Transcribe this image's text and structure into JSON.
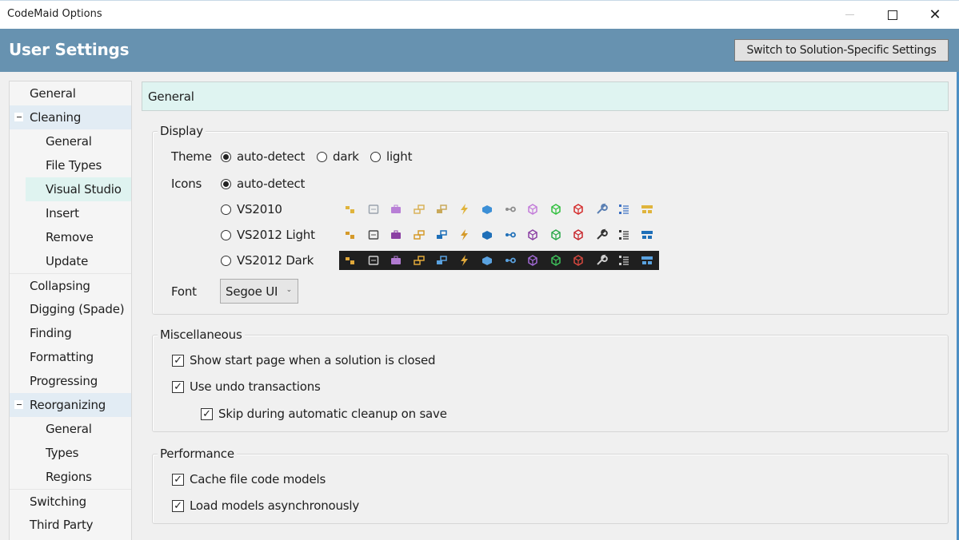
{
  "window": {
    "title": "CodeMaid Options",
    "controls": {
      "minimize": "minimize",
      "maximize": "maximize",
      "close": "close"
    }
  },
  "header": {
    "title": "User Settings",
    "switch_button": "Switch to Solution-Specific Settings"
  },
  "sidebar": {
    "items": [
      {
        "label": "General",
        "level": 0
      },
      {
        "label": "Cleaning",
        "level": 0,
        "expanded": true
      },
      {
        "label": "General",
        "level": 1
      },
      {
        "label": "File Types",
        "level": 1
      },
      {
        "label": "Visual Studio",
        "level": 1,
        "selected": true
      },
      {
        "label": "Insert",
        "level": 1
      },
      {
        "label": "Remove",
        "level": 1
      },
      {
        "label": "Update",
        "level": 1
      },
      {
        "label": "Collapsing",
        "level": 0
      },
      {
        "label": "Digging (Spade)",
        "level": 0
      },
      {
        "label": "Finding",
        "level": 0
      },
      {
        "label": "Formatting",
        "level": 0
      },
      {
        "label": "Progressing",
        "level": 0
      },
      {
        "label": "Reorganizing",
        "level": 0,
        "expanded": true
      },
      {
        "label": "General",
        "level": 1
      },
      {
        "label": "Types",
        "level": 1
      },
      {
        "label": "Regions",
        "level": 1
      },
      {
        "label": "Switching",
        "level": 0
      },
      {
        "label": "Third Party",
        "level": 0
      }
    ]
  },
  "panel": {
    "title": "General",
    "display": {
      "legend": "Display",
      "theme": {
        "label": "Theme",
        "options": [
          "auto-detect",
          "dark",
          "light"
        ],
        "selected": "auto-detect"
      },
      "icons": {
        "label": "Icons",
        "options": [
          "auto-detect",
          "VS2010",
          "VS2012 Light",
          "VS2012 Dark"
        ],
        "selected": "auto-detect",
        "preview_icons": [
          "build-progress",
          "comment",
          "toolbox",
          "class",
          "interface",
          "lightning",
          "cube",
          "key-link",
          "purple-cube",
          "green-cube",
          "red-cube",
          "settings",
          "list",
          "layout"
        ]
      },
      "font": {
        "label": "Font",
        "value": "Segoe UI"
      }
    },
    "misc": {
      "legend": "Miscellaneous",
      "options": [
        {
          "label": "Show start page when a solution is closed",
          "checked": true
        },
        {
          "label": "Use undo transactions",
          "checked": true
        },
        {
          "label": "Skip during automatic cleanup on save",
          "checked": true
        }
      ]
    },
    "performance": {
      "legend": "Performance",
      "options": [
        {
          "label": "Cache file code models",
          "checked": true
        },
        {
          "label": "Load models asynchronously",
          "checked": true
        }
      ]
    }
  },
  "colors": {
    "header_bg": "#6792b0",
    "panel_title_bg": "#dff4f1",
    "selected_item_bg": "#dff3f0",
    "group_item_bg": "#e2ecf4"
  }
}
